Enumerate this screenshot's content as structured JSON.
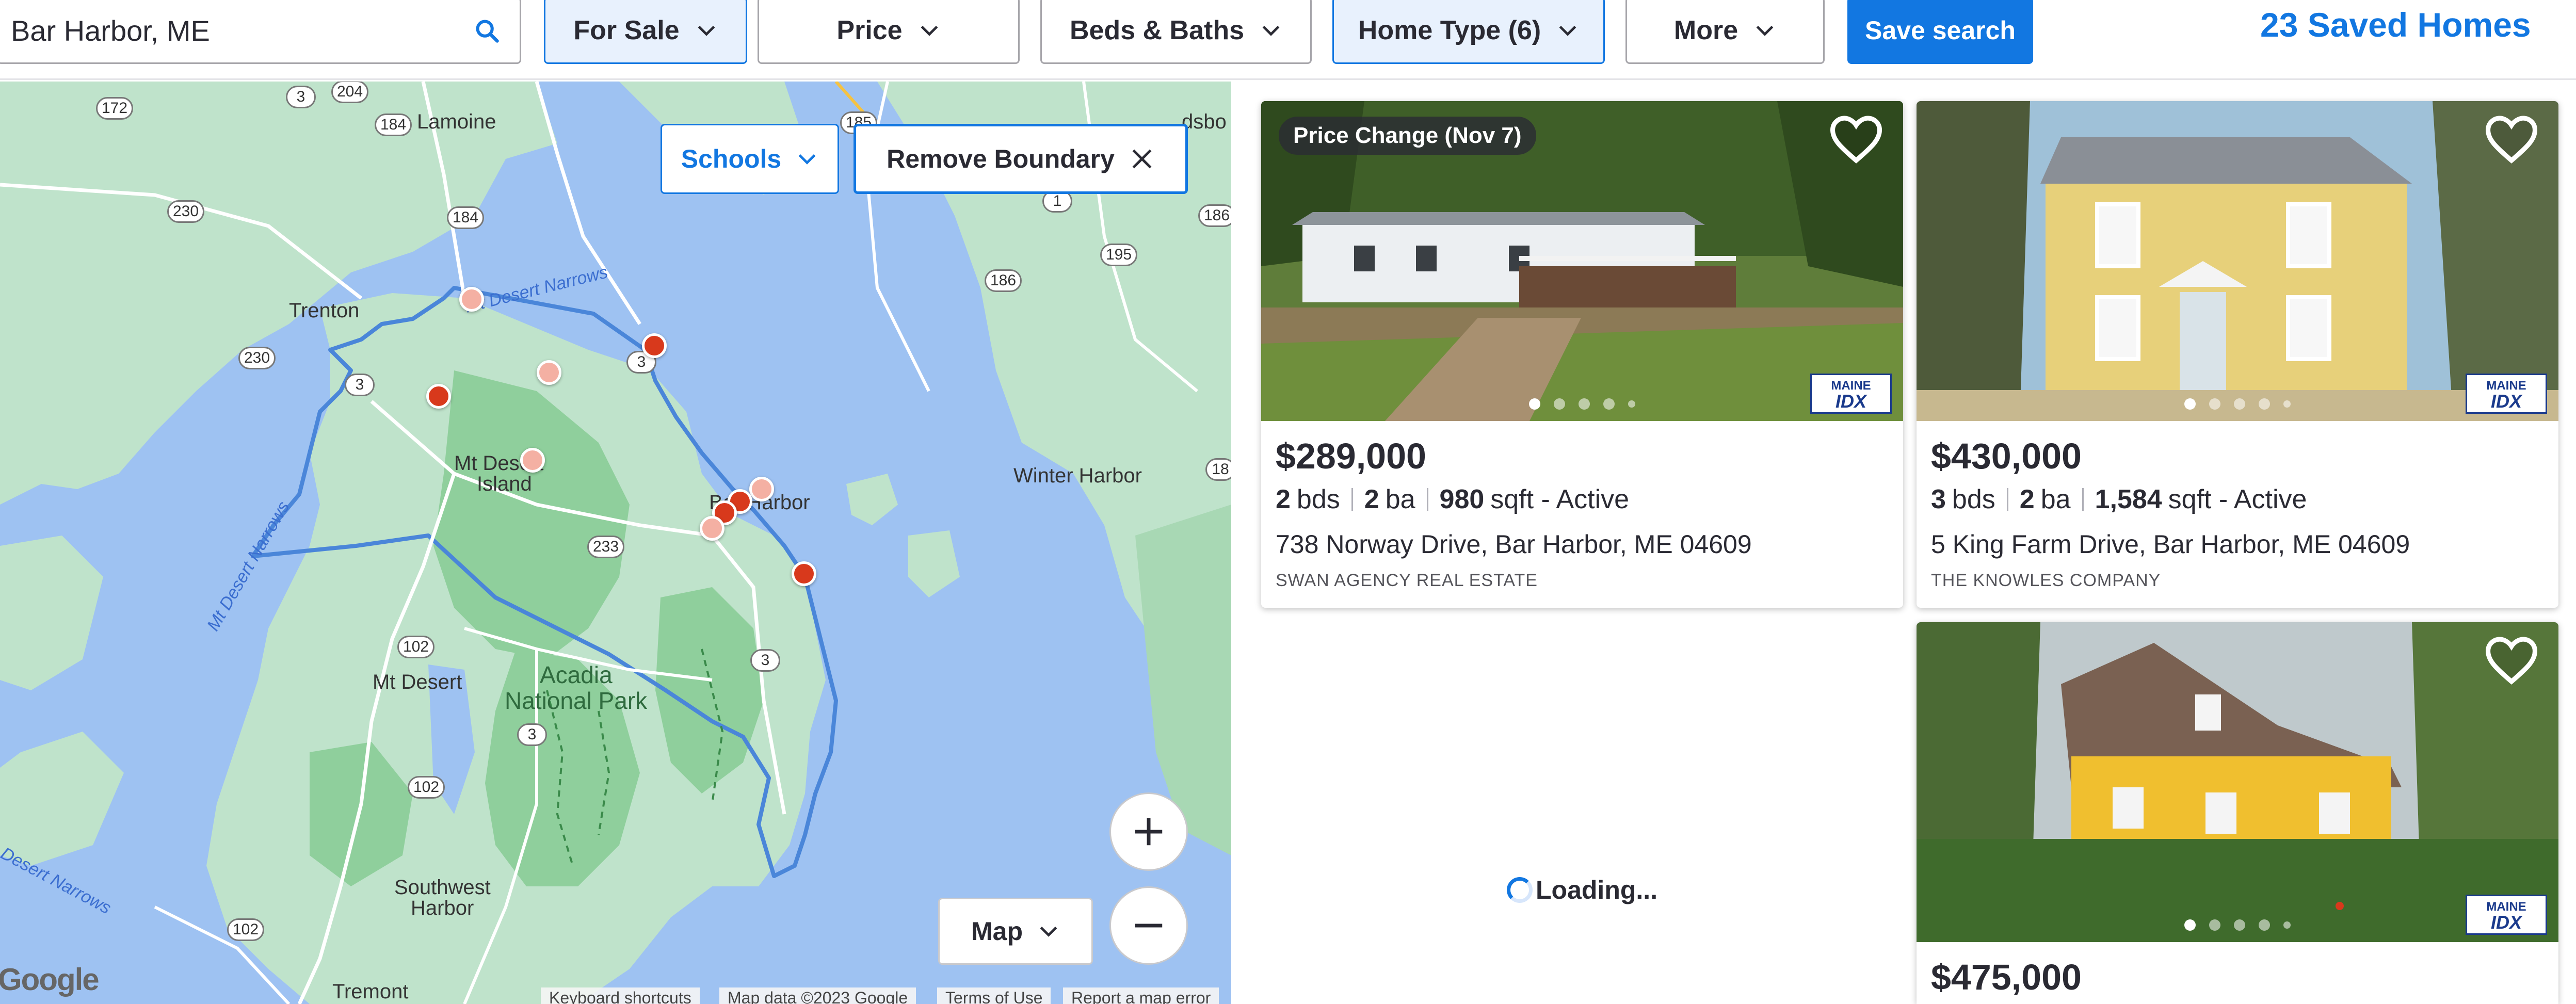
{
  "search": {
    "value": "Bar Harbor, ME"
  },
  "filters": [
    {
      "label": "For Sale",
      "active": true
    },
    {
      "label": "Price",
      "active": false
    },
    {
      "label": "Beds & Baths",
      "active": false
    },
    {
      "label": "Home Type (6)",
      "active": true
    },
    {
      "label": "More",
      "active": false
    }
  ],
  "save_search_label": "Save search",
  "saved_homes_label": "23 Saved Homes",
  "map": {
    "schools_label": "Schools",
    "remove_boundary_label": "Remove Boundary",
    "map_type_label": "Map",
    "labels": {
      "lamoine": "Lamoine",
      "trenton": "Trenton",
      "mt_desert_island_1": "Mt Desert",
      "mt_desert_island_2": "Island",
      "bar_harbor": "Bar Harbor",
      "winter_harbor": "Winter Harbor",
      "mt_desert": "Mt Desert",
      "acadia_1": "Acadia",
      "acadia_2": "National Park",
      "southwest_1": "Southwest",
      "southwest_2": "Harbor",
      "tremont": "Tremont",
      "ellsworth_frag": "dsbo",
      "mt_desert_narrows_top": "Mt Desert Narrows",
      "mt_desert_narrows_left": "Mt Desert Narrows",
      "desert_narrows_bottom": "Desert Narrows"
    },
    "routes": {
      "r172": "172",
      "r3a": "3",
      "r204": "204",
      "r184a": "184",
      "r230": "230",
      "r184b": "184",
      "r230b": "230",
      "r3b": "3",
      "r3c": "3",
      "r233": "233",
      "r102a": "102",
      "r3d": "3",
      "r102b": "102",
      "r102c": "102",
      "r195": "195",
      "r186a": "186",
      "r186b": "186",
      "r185": "185",
      "r1": "1",
      "r18": "18"
    },
    "attribution": {
      "google": "Google",
      "keyboard": "Keyboard shortcuts",
      "data": "Map data ©2023 Google",
      "terms": "Terms of Use",
      "report": "Report a map error"
    }
  },
  "listings": [
    {
      "badge": "Price Change (Nov 7)",
      "price": "$289,000",
      "beds": "2",
      "beds_unit": "bds",
      "baths": "2",
      "baths_unit": "ba",
      "sqft": "980",
      "sqft_unit": "sqft - Active",
      "address": "738 Norway Drive, Bar Harbor, ME 04609",
      "agency": "SWAN AGENCY REAL ESTATE",
      "mls_top": "MAINE",
      "mls_bottom": "IDX"
    },
    {
      "price": "$430,000",
      "beds": "3",
      "beds_unit": "bds",
      "baths": "2",
      "baths_unit": "ba",
      "sqft": "1,584",
      "sqft_unit": "sqft - Active",
      "address": "5 King Farm Drive, Bar Harbor, ME 04609",
      "agency": "THE KNOWLES COMPANY",
      "mls_top": "MAINE",
      "mls_bottom": "IDX"
    },
    {
      "price": "$475,000",
      "mls_top": "MAINE",
      "mls_bottom": "IDX"
    }
  ],
  "loading_label": "Loading...",
  "colors": {
    "accent": "#1277e1",
    "pin_hot": "#d8391c",
    "pin_soft": "#f4b0a3",
    "water": "#9ec2f2",
    "land": "#bfe3cb",
    "park": "#8fcf9c"
  }
}
